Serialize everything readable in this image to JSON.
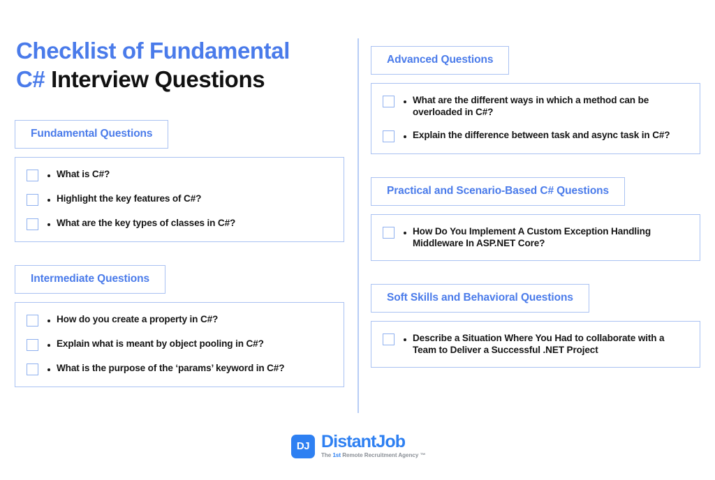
{
  "title": {
    "line1_accent": "Checklist of Fundamental",
    "line2_accent": "C#",
    "line2_dark": "Interview Questions"
  },
  "divider_color": "#b7cdf5",
  "accent_color": "#4a7bea",
  "border_color": "#a9c1f2",
  "left_column": [
    {
      "header": "Fundamental Questions",
      "questions": [
        "What is C#?",
        "Highlight the key features of C#?",
        "What are the key types of classes in C#?"
      ]
    },
    {
      "header": "Intermediate Questions",
      "questions": [
        "How do you create a property in C#?",
        "Explain what is meant by object pooling in C#?",
        "What is the purpose of the ‘params’ keyword in C#?"
      ]
    }
  ],
  "right_column": [
    {
      "header": "Advanced Questions",
      "questions": [
        "What are the different ways in which a method can be overloaded in C#?",
        "Explain the difference between task and async task in C#?"
      ]
    },
    {
      "header": "Practical and Scenario-Based C# Questions",
      "questions": [
        "How Do You Implement A Custom Exception Handling Middleware In ASP.NET Core?"
      ]
    },
    {
      "header": "Soft Skills and Behavioral Questions",
      "questions": [
        "Describe a Situation Where You Had to collaborate with a Team to Deliver a Successful .NET Project"
      ]
    }
  ],
  "footer": {
    "logo_mark": "DJ",
    "logo_name": "DistantJob",
    "tagline_prefix": "The",
    "tagline_highlight": "1st",
    "tagline_suffix": "Remote Recruitment Agency ™"
  }
}
